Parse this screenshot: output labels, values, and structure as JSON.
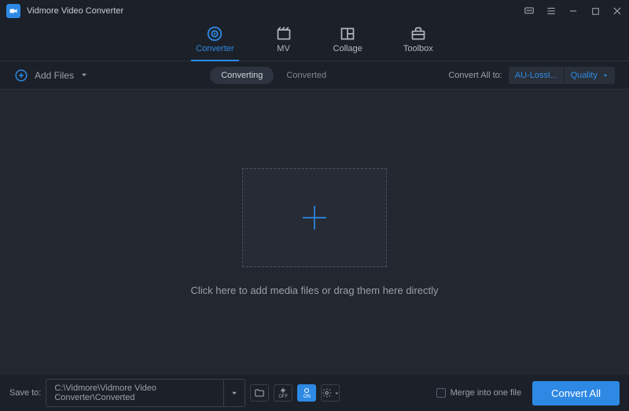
{
  "app": {
    "title": "Vidmore Video Converter"
  },
  "tabs": {
    "items": [
      {
        "label": "Converter"
      },
      {
        "label": "MV"
      },
      {
        "label": "Collage"
      },
      {
        "label": "Toolbox"
      }
    ]
  },
  "toolbar": {
    "add_files_label": "Add Files",
    "seg_converting": "Converting",
    "seg_converted": "Converted",
    "convert_all_label": "Convert All to:",
    "target_format": "AU-Lossl...",
    "target_quality": "Quality"
  },
  "main": {
    "drop_text": "Click here to add media files or drag them here directly"
  },
  "footer": {
    "save_label": "Save to:",
    "save_path": "C:\\Vidmore\\Vidmore Video Converter\\Converted",
    "merge_label": "Merge into one file",
    "convert_btn": "Convert All",
    "hw_off": "OFF",
    "gpu_on": "ON"
  }
}
